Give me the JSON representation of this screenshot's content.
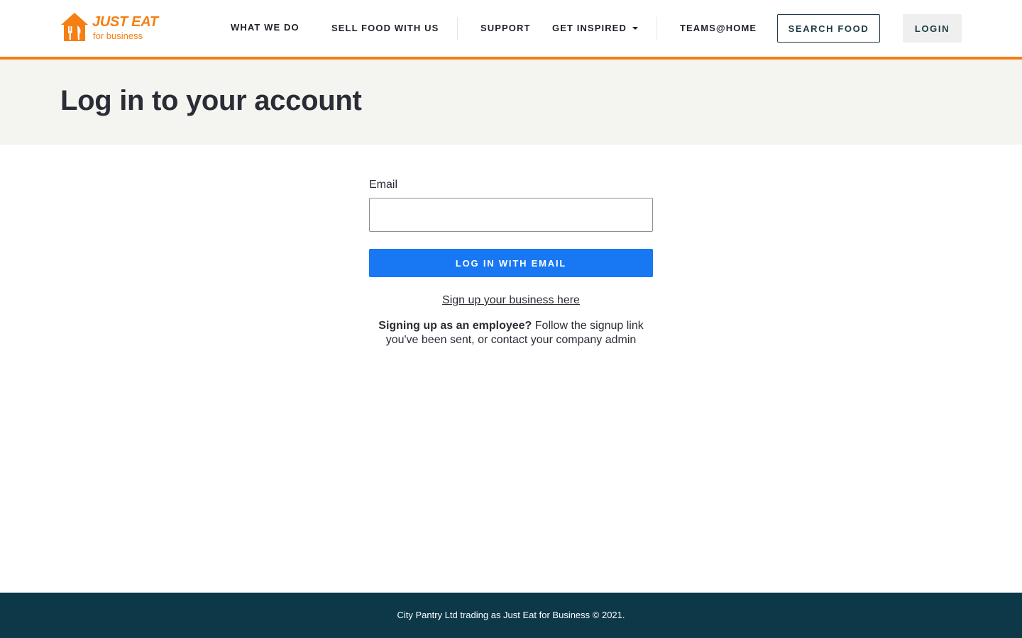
{
  "brand": {
    "name": "JUST EAT",
    "tagline": "for business",
    "icon": "house-cutlery-icon",
    "color": "#f57f12"
  },
  "nav": {
    "what_we_do": "WHAT WE DO",
    "sell_food": "SELL FOOD WITH US",
    "support": "SUPPORT",
    "get_inspired": "GET INSPIRED",
    "teams_at_home": "TEAMS@HOME",
    "search_food": "SEARCH FOOD",
    "login": "LOGIN"
  },
  "hero": {
    "title": "Log in to your account"
  },
  "form": {
    "email_label": "Email",
    "email_value": "",
    "submit_label": "LOG IN WITH EMAIL",
    "signup_link": "Sign up your business here",
    "employee_bold": "Signing up as an employee?",
    "employee_text": "Follow the signup link you've been sent, or contact your company admin"
  },
  "footer": {
    "copyright": "City Pantry Ltd trading as Just Eat for Business © 2021."
  },
  "colors": {
    "accent": "#f57f12",
    "primary_button": "#1877f2",
    "footer_bg": "#0c3848",
    "hero_bg": "#f4f4f1"
  }
}
